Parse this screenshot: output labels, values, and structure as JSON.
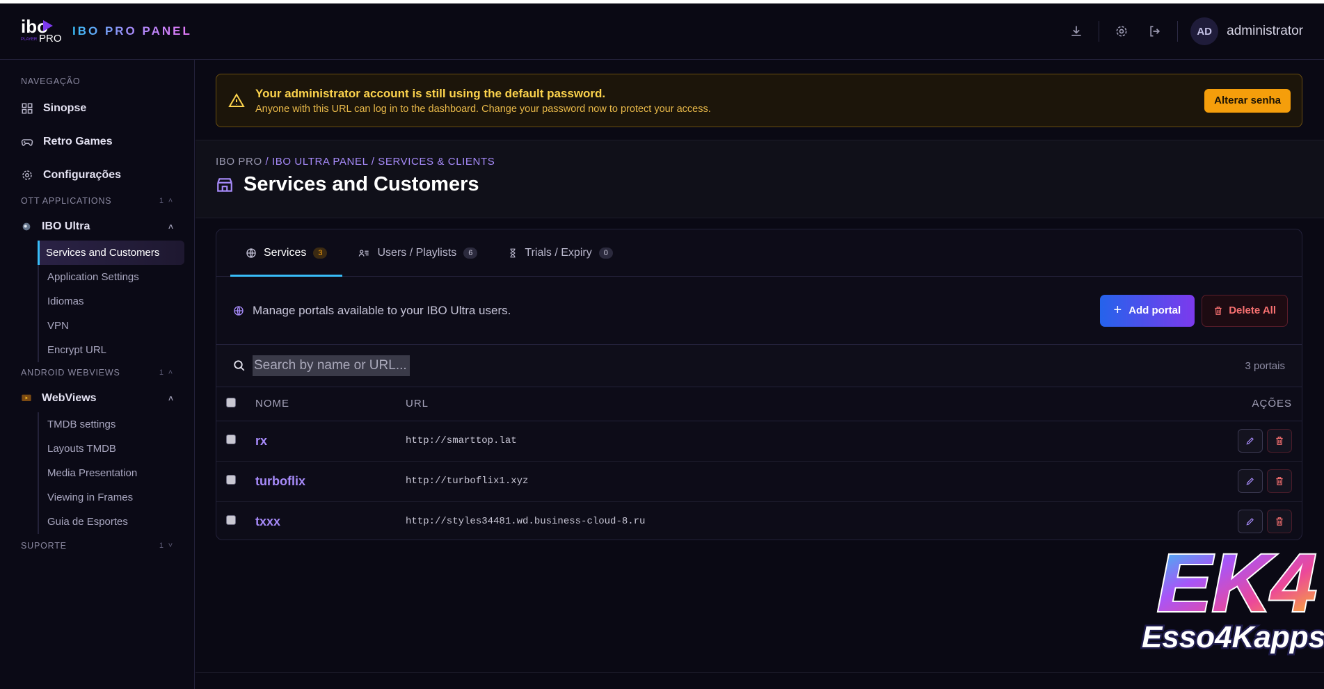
{
  "header": {
    "logo_text_top": "ibo",
    "logo_text_sub": "PRO",
    "logo_text_small": "PLAYER",
    "brand": "IBO PRO PANEL",
    "avatar_initials": "AD",
    "username": "administrator"
  },
  "sidebar": {
    "nav_label": "NAVEGAÇÃO",
    "nav_items": [
      {
        "label": "Sinopse",
        "icon": "grid-icon"
      },
      {
        "label": "Retro Games",
        "icon": "gamepad-icon"
      },
      {
        "label": "Configurações",
        "icon": "gear-icon"
      }
    ],
    "ott_label": "OTT APPLICATIONS",
    "ott_count": "1",
    "ibo_group": "IBO Ultra",
    "ibo_items": [
      "Services and Customers",
      "Application Settings",
      "Idiomas",
      "VPN",
      "Encrypt URL"
    ],
    "android_label": "ANDROID WEBVIEWS",
    "android_count": "1",
    "webviews_group": "WebViews",
    "webviews_items": [
      "TMDB settings",
      "Layouts TMDB",
      "Media Presentation",
      "Viewing in Frames",
      "Guia de Esportes"
    ],
    "support_label": "SUPORTE",
    "support_count": "1"
  },
  "alert": {
    "title": "Your administrator account is still using the default password.",
    "text": "Anyone with this URL can log in to the dashboard. Change your password now to protect your access.",
    "button": "Alterar senha"
  },
  "breadcrumb": {
    "root": "IBO PRO",
    "rest": " / IBO ULTRA PANEL / SERVICES & CLIENTS"
  },
  "page_title": "Services and Customers",
  "tabs": [
    {
      "label": "Services",
      "count": "3"
    },
    {
      "label": "Users / Playlists",
      "count": "6"
    },
    {
      "label": "Trials / Expiry",
      "count": "0"
    }
  ],
  "toolbar": {
    "description": "Manage portals available to your IBO Ultra users.",
    "add_label": "Add portal",
    "delete_label": "Delete All"
  },
  "search": {
    "placeholder": "Search by name or URL...",
    "count_text": "3 portais"
  },
  "table": {
    "headers": {
      "name": "NOME",
      "url": "URL",
      "actions": "AÇÕES"
    },
    "rows": [
      {
        "name": "rx",
        "url": "http://smarttop.lat"
      },
      {
        "name": "turboflix",
        "url": "http://turboflix1.xyz"
      },
      {
        "name": "txxx",
        "url": "http://styles34481.wd.business-cloud-8.ru"
      }
    ]
  },
  "watermark": {
    "big": "EK4",
    "small": "Esso4Kapps"
  },
  "colors": {
    "accent": "#a78bfa",
    "active_indicator": "#38bdf8",
    "warning": "#f59e0b",
    "danger": "#f87171"
  }
}
